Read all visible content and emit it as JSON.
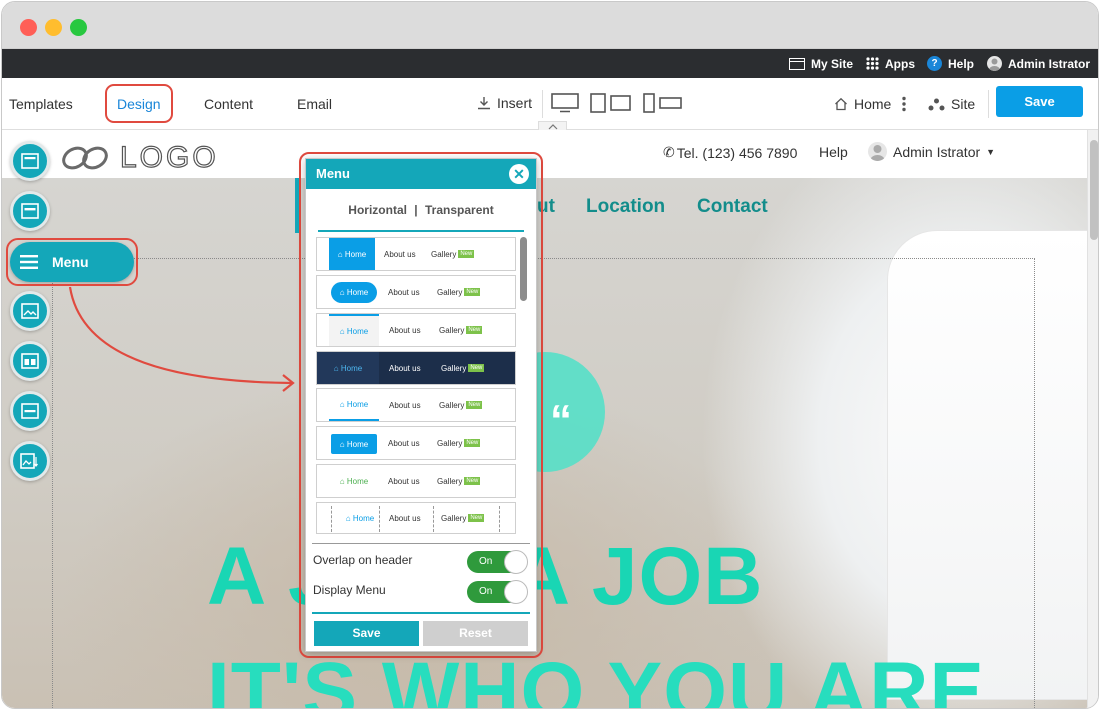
{
  "window": {
    "controls": [
      "close",
      "minimize",
      "maximize"
    ],
    "control_colors": [
      "#ff5f57",
      "#ffbd2e",
      "#28c840"
    ]
  },
  "topbar": {
    "my_site": "My Site",
    "apps": "Apps",
    "help": "Help",
    "user": "Admin Istrator"
  },
  "toolbar": {
    "tabs": [
      "Templates",
      "Design",
      "Content",
      "Email"
    ],
    "active_tab": "Design",
    "insert": "Insert",
    "page": "Home",
    "site": "Site",
    "save": "Save"
  },
  "site": {
    "logo": "LOGO",
    "tel": "Tel. (123) 456 7890",
    "help": "Help",
    "user": "Admin Istrator",
    "nav": {
      "partial": "ut",
      "location": "Location",
      "contact": "Contact"
    },
    "headline1": "A J     N'T A JOB",
    "headline2": "IT'S WHO YOU ARE"
  },
  "sidebar": {
    "menu_label": "Menu"
  },
  "menu_panel": {
    "title": "Menu",
    "tab_left": "Horizontal",
    "tab_sep": "|",
    "tab_right": "Transparent",
    "options": [
      {
        "home": "Home",
        "about": "About us",
        "gallery": "Gallery",
        "tag": "New"
      },
      {
        "home": "Home",
        "about": "About us",
        "gallery": "Gallery",
        "tag": "New"
      },
      {
        "home": "Home",
        "about": "About us",
        "gallery": "Gallery",
        "tag": "New"
      },
      {
        "home": "Home",
        "about": "About us",
        "gallery": "Gallery",
        "tag": "New"
      },
      {
        "home": "Home",
        "about": "About us",
        "gallery": "Gallery",
        "tag": "New"
      },
      {
        "home": "Home",
        "about": "About us",
        "gallery": "Gallery",
        "tag": "New"
      },
      {
        "home": "Home",
        "about": "About us",
        "gallery": "Gallery",
        "tag": "New"
      },
      {
        "home": "Home",
        "about": "About us",
        "gallery": "Gallery",
        "tag": "New"
      }
    ],
    "overlap_label": "Overlap on header",
    "overlap_value": "On",
    "display_label": "Display Menu",
    "display_value": "On",
    "save": "Save",
    "reset": "Reset"
  },
  "colors": {
    "accent": "#14a7b9",
    "primary_button": "#0a9ee6",
    "highlight": "#e04a3f",
    "headline": "#19d6b4",
    "nav": "#138d8b"
  }
}
